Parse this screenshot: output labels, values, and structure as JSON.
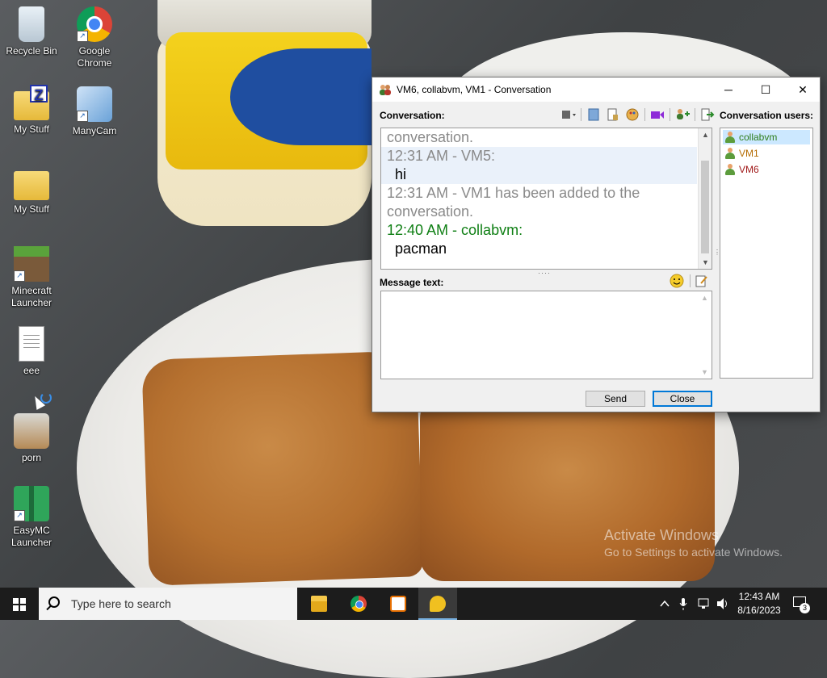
{
  "desktop": {
    "icons": [
      {
        "label": "Recycle Bin",
        "icon": "recycle-bin-icon"
      },
      {
        "label": "Google Chrome",
        "icon": "chrome-icon"
      },
      {
        "label": "My Stuff",
        "icon": "folder-icon"
      },
      {
        "label": "ManyCam",
        "icon": "manycam-icon"
      },
      {
        "label": "My Stuff",
        "icon": "folder-icon"
      },
      {
        "label": "Minecraft Launcher",
        "icon": "minecraft-icon"
      },
      {
        "label": "eee",
        "icon": "text-file-icon"
      },
      {
        "label": "porn",
        "icon": "image-file-icon"
      },
      {
        "label": "EasyMC Launcher",
        "icon": "gift-icon"
      }
    ],
    "watermark": {
      "title": "Activate Windows",
      "subtitle": "Go to Settings to activate Windows."
    }
  },
  "window": {
    "title": "VM6, collabvm, VM1 - Conversation",
    "controls": {
      "minimize": "─",
      "maximize": "☐",
      "close": "✕"
    },
    "conversation_label": "Conversation:",
    "message_label": "Message text:",
    "users_label": "Conversation users:",
    "conversation_lines": [
      {
        "text": "conversation.",
        "style": "gray"
      },
      {
        "text": "12:31 AM - VM5:",
        "style": "gray-hl"
      },
      {
        "text": "hi",
        "style": "msg-hl"
      },
      {
        "text": "12:31 AM - VM1 has been added to the",
        "style": "gray"
      },
      {
        "text": "conversation.",
        "style": "gray"
      },
      {
        "text": "12:40 AM - collabvm:",
        "style": "green"
      },
      {
        "text": "pacman",
        "style": "msg"
      }
    ],
    "message_text": "",
    "users": [
      {
        "name": "collabvm",
        "color": "#2e7d1a",
        "selected": true
      },
      {
        "name": "VM1",
        "color": "#b36b00",
        "selected": false
      },
      {
        "name": "VM6",
        "color": "#a01818",
        "selected": false
      }
    ],
    "buttons": {
      "send": "Send",
      "close": "Close"
    }
  },
  "taskbar": {
    "search_placeholder": "Type here to search",
    "apps": [
      "file-explorer",
      "google-chrome",
      "java",
      "conversation"
    ],
    "clock_time": "12:43 AM",
    "clock_date": "8/16/2023",
    "notification_count": "3"
  }
}
